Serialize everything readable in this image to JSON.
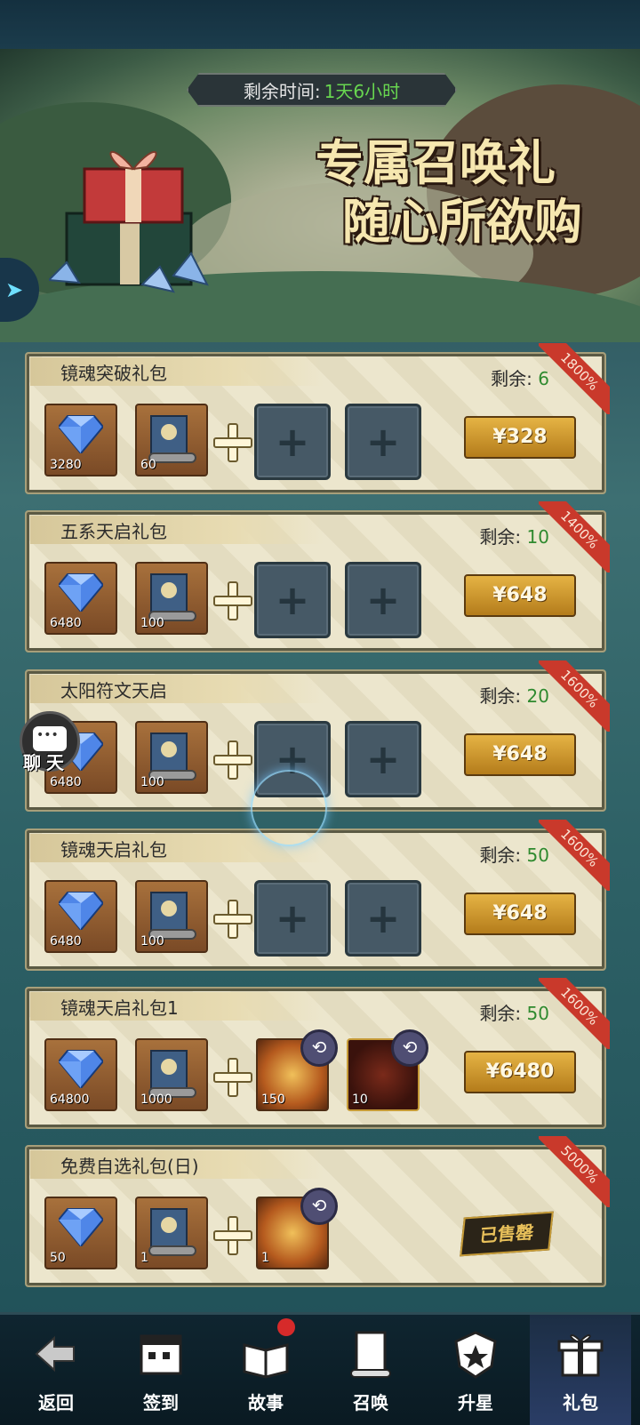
{
  "timer": {
    "label": "剩余时间:",
    "value": "1天6小时"
  },
  "banner": {
    "title_line1": "专属召唤礼",
    "title_line2": "随心所欲购"
  },
  "packs": [
    {
      "name": "镜魂突破礼包",
      "remain_label": "剩余:",
      "remain": "6",
      "badge": "1800%",
      "gems": "3280",
      "scrolls": "60",
      "price": "¥328"
    },
    {
      "name": "五系天启礼包",
      "remain_label": "剩余:",
      "remain": "10",
      "badge": "1400%",
      "gems": "6480",
      "scrolls": "100",
      "price": "¥648"
    },
    {
      "name": "太阳符文天启",
      "remain_label": "剩余:",
      "remain": "20",
      "badge": "1600%",
      "gems": "6480",
      "scrolls": "100",
      "price": "¥648"
    },
    {
      "name": "镜魂天启礼包",
      "remain_label": "剩余:",
      "remain": "50",
      "badge": "1600%",
      "gems": "6480",
      "scrolls": "100",
      "price": "¥648"
    },
    {
      "name": "镜魂天启礼包1",
      "remain_label": "剩余:",
      "remain": "50",
      "badge": "1600%",
      "gems": "64800",
      "scrolls": "1000",
      "hero1": "150",
      "hero2": "10",
      "price": "¥6480"
    },
    {
      "name": "免费自选礼包(日)",
      "badge": "5000%",
      "gems": "50",
      "scrolls": "1",
      "hero1": "1",
      "status": "已售罄"
    }
  ],
  "chat": {
    "label": "聊天"
  },
  "nav": [
    {
      "label": "返回",
      "icon": "back-arrow-icon"
    },
    {
      "label": "签到",
      "icon": "calendar-icon"
    },
    {
      "label": "故事",
      "icon": "book-icon"
    },
    {
      "label": "召唤",
      "icon": "scroll-icon"
    },
    {
      "label": "升星",
      "icon": "star-shield-icon"
    },
    {
      "label": "礼包",
      "icon": "gift-icon"
    }
  ],
  "colors": {
    "accent_green": "#68d650",
    "ribbon_red": "#c9392b",
    "price_gold": "#e5b344"
  }
}
